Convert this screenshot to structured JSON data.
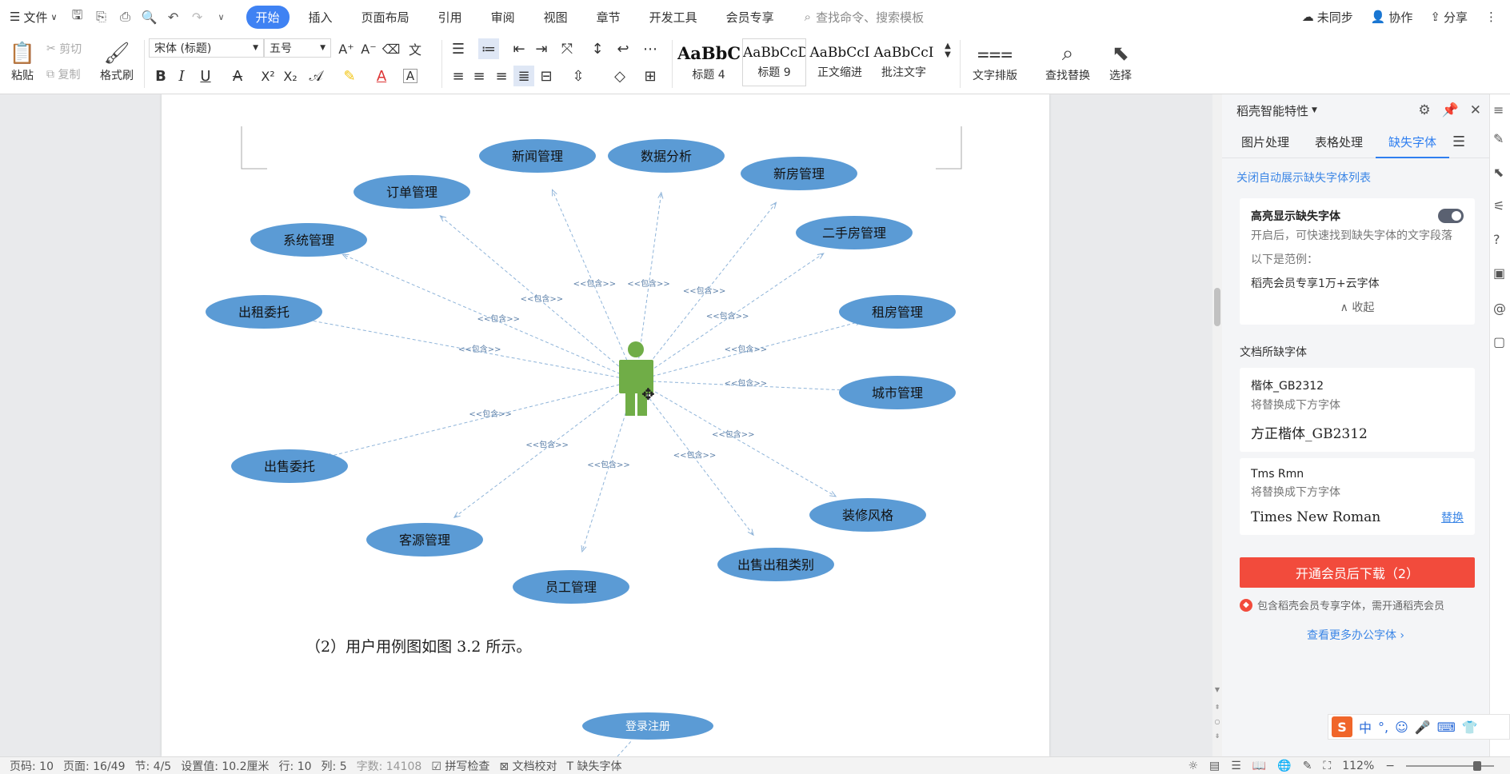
{
  "menubar": {
    "file": "文件",
    "tabs": [
      "开始",
      "插入",
      "页面布局",
      "引用",
      "审阅",
      "视图",
      "章节",
      "开发工具",
      "会员专享"
    ],
    "active_tab": "开始",
    "search_placeholder": "查找命令、搜索模板",
    "right": {
      "sync": "未同步",
      "collab": "协作",
      "share": "分享"
    }
  },
  "ribbon": {
    "paste": "粘贴",
    "cut": "剪切",
    "copy": "复制",
    "format_painter": "格式刷",
    "font_name": "宋体 (标题)",
    "font_size": "五号",
    "styles": [
      {
        "sample": "AaBbC",
        "label": "标题 4"
      },
      {
        "sample": "AaBbCcDd",
        "label": "标题 9"
      },
      {
        "sample": "AaBbCcI",
        "label": "正文缩进"
      },
      {
        "sample": "AaBbCcI",
        "label": "批注文字"
      }
    ],
    "text_layout": "文字排版",
    "find_replace": "查找替换",
    "select": "选择"
  },
  "diagram": {
    "actor": "user-actor",
    "relation": "<<包含>>",
    "use_cases": [
      "新闻管理",
      "数据分析",
      "新房管理",
      "订单管理",
      "二手房管理",
      "系统管理",
      "租房管理",
      "出租委托",
      "城市管理",
      "出售委托",
      "装修风格",
      "客源管理",
      "出售出租类别",
      "员工管理"
    ],
    "next_use_case": "登录注册"
  },
  "document": {
    "caption": "（2）用户用例图如图 3.2 所示。"
  },
  "panel": {
    "title": "稻壳智能特性",
    "tabs": [
      "图片处理",
      "表格处理",
      "缺失字体"
    ],
    "active_tab": "缺失字体",
    "auto_show_link": "关闭自动展示缺失字体列表",
    "highlight_title": "高亮显示缺失字体",
    "highlight_desc": "开启后，可快速找到缺失字体的文字段落",
    "example_label": "以下是范例：",
    "example_text": "稻壳会员专享1万+云字体",
    "collapse": "收起",
    "missing_section": "文档所缺字体",
    "fonts": [
      {
        "name": "楷体_GB2312",
        "replace_label": "将替换成下方字体",
        "sample": "方正楷体_GB2312",
        "action": ""
      },
      {
        "name": "Tms Rmn",
        "replace_label": "将替换成下方字体",
        "sample": "Times New Roman",
        "action": "替换"
      }
    ],
    "download_button": "开通会员后下载（2）",
    "note": "包含稻壳会员专享字体，需开通稻壳会员",
    "more_link": "查看更多办公字体"
  },
  "ime": {
    "lang": "中"
  },
  "status": {
    "page_num": "页码: 10",
    "page": "页面: 16/49",
    "section": "节: 4/5",
    "setting": "设置值: 10.2厘米",
    "row": "行: 10",
    "col": "列: 5",
    "words": "字数: 14108",
    "spell": "拼写检查",
    "proof": "文档校对",
    "missing_font": "缺失字体",
    "zoom": "112%"
  },
  "colors": {
    "accent": "#3f82f3",
    "ellipse": "#5b9bd5",
    "actor": "#70ad47",
    "download": "#f24b3c"
  }
}
